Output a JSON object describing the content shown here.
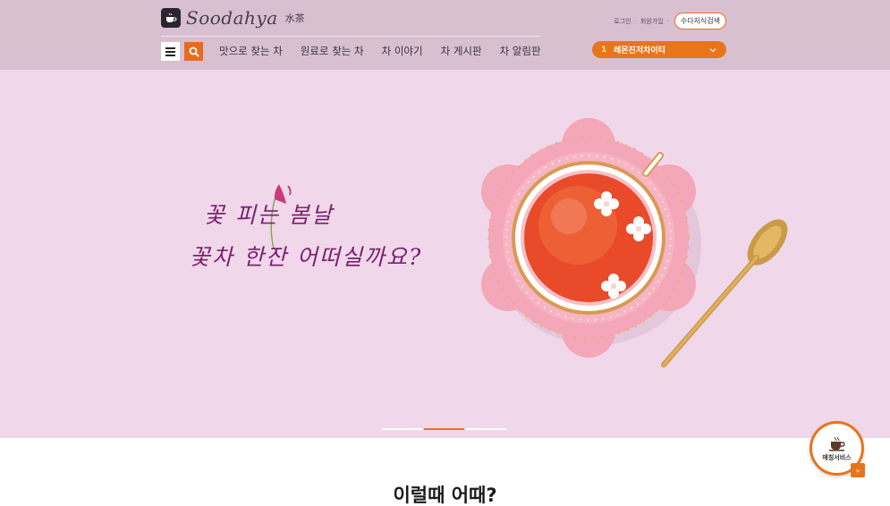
{
  "header": {
    "logo": {
      "name": "Soodahya",
      "sub": "水茶"
    },
    "util": {
      "login": "로그인",
      "signup": "회원가입",
      "search_pill": "수다지식검색"
    },
    "nav": [
      "맛으로 찾는 차",
      "원료로 찾는 차",
      "차 이야기",
      "차 게시판",
      "차 알림판"
    ],
    "rank": {
      "number": "1",
      "text": "레몬진저차이티"
    }
  },
  "hero": {
    "line1": "꽃 피는 봄날",
    "line2": "꽃차 한잔 어떠실까요?",
    "slides": 3,
    "active_slide": 1
  },
  "section": {
    "title": "이럴때 어때?"
  },
  "matching": {
    "label": "매칭서비스"
  },
  "colors": {
    "accent": "#e8711c",
    "header_bg": "#d8c0d0",
    "hero_bg": "#f0d8ea",
    "hero_text": "#7b1f6e"
  },
  "icons": [
    "logo-cup-icon",
    "menu-icon",
    "search-icon",
    "chevron-down-icon",
    "coffee-cup-icon",
    "double-chevron-right-icon"
  ]
}
